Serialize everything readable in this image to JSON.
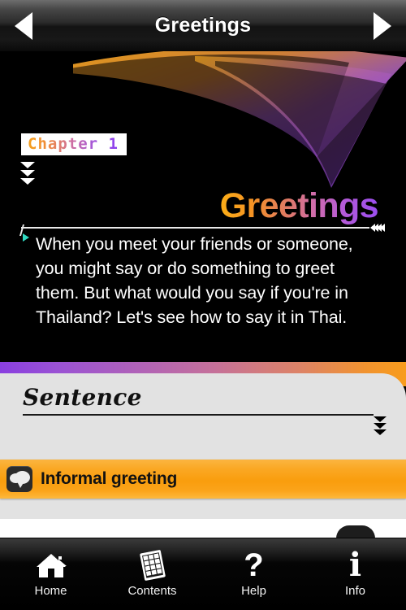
{
  "header": {
    "title": "Greetings",
    "prev_icon": "triangle-left-icon",
    "next_icon": "triangle-right-icon"
  },
  "content": {
    "chapter_badge": "Chapter 1",
    "title": "Greetings",
    "body": "When you meet your friends or someone, you might say or do something to greet them. But what would you say if you're in Thailand? Let's see how to say it in Thai.",
    "play_marker_color": "#2fd8c0",
    "gradient_start": "#fcae17",
    "gradient_end": "#9b4ef0"
  },
  "section": {
    "label": "Sentence",
    "expand_icon": "chevron-double-down-icon"
  },
  "rows": [
    {
      "label": "Informal greeting",
      "icon": "speech-bubbles-icon",
      "color": "#f99d0d"
    }
  ],
  "tabbar": {
    "items": [
      {
        "label": "Home",
        "icon": "home-icon"
      },
      {
        "label": "Contents",
        "icon": "grid-contents-icon"
      },
      {
        "label": "Help",
        "icon": "question-mark-icon",
        "glyph": "?"
      },
      {
        "label": "Info",
        "icon": "info-i-icon",
        "glyph": "i"
      }
    ]
  }
}
